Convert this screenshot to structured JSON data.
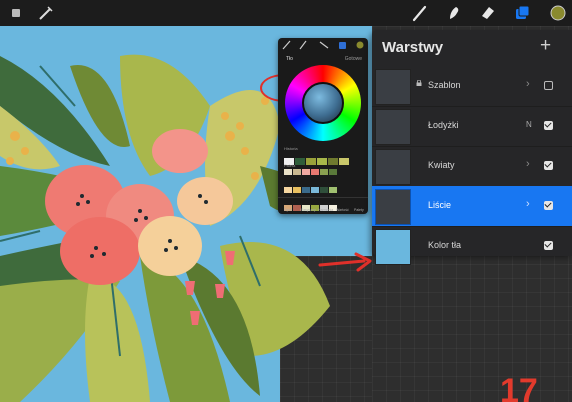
{
  "colors": {
    "canvas_bg": "#6ab7de",
    "panel_bg": "#262628",
    "selected_layer": "#1877f2",
    "step_number": "#e23a2c",
    "active_color_chip": "#2f6fd6",
    "active_swatch": "#8a8a2e"
  },
  "toolbar": {
    "tools": [
      {
        "icon": "brush-icon"
      },
      {
        "icon": "smudge-icon"
      },
      {
        "icon": "eraser-icon"
      },
      {
        "icon": "layers-icon"
      },
      {
        "icon": "color-swatch-icon"
      }
    ]
  },
  "color_picker": {
    "title": "Tło",
    "right_label": "Gotowe",
    "history_label": "Historia",
    "palette_label": "Paleta",
    "history_colors": [
      "#f0f0f0",
      "#2f5d3a",
      "#9aa23a",
      "#a8b84a",
      "#6f7a2e",
      "#c9c76a"
    ],
    "palette_colors": [
      "#e9e1c8",
      "#c8b890",
      "#f0a8a0",
      "#e87870",
      "#8aa050",
      "#5a7a3a",
      "#f5d6a0",
      "#e8c060",
      "#3a6a8a",
      "#7ab8d8",
      "#2f4f3a",
      "#a0c070",
      "#d8a878",
      "#b06050",
      "#e8e8c8",
      "#98a840",
      "#d0d0d0",
      "#f5f0e0"
    ],
    "tabs_bottom": [
      "Dysk",
      "Klasyczny",
      "Harmonia",
      "Wartość",
      "Palety"
    ]
  },
  "layers_panel": {
    "title": "Warstwy",
    "add_label": "+",
    "items": [
      {
        "name": "Szablon",
        "locked": true,
        "checked": false,
        "selected": false,
        "mode": ""
      },
      {
        "name": "Łodyżki",
        "locked": false,
        "checked": true,
        "selected": false,
        "mode": "N"
      },
      {
        "name": "Kwiaty",
        "locked": false,
        "checked": true,
        "selected": false,
        "mode": ""
      },
      {
        "name": "Liście",
        "locked": false,
        "checked": true,
        "selected": true,
        "mode": ""
      },
      {
        "name": "Kolor tła",
        "locked": false,
        "checked": true,
        "selected": false,
        "mode": ""
      }
    ]
  },
  "annotation": {
    "step_number": "17"
  }
}
